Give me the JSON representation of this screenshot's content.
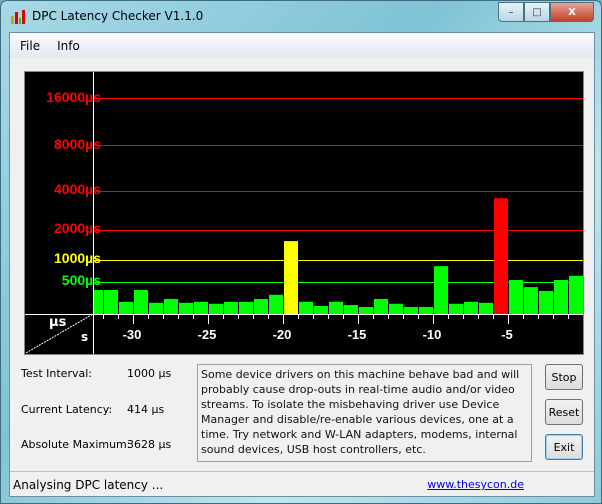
{
  "window": {
    "title": "DPC Latency Checker V1.1.0",
    "minimize": "–",
    "maximize": "□",
    "close": "X"
  },
  "menu": {
    "items": [
      "File",
      "Info"
    ]
  },
  "chart_data": {
    "type": "bar",
    "ylabels": [
      "16000µs",
      "8000µs",
      "4000µs",
      "2000µs",
      "1000µs",
      "500µs"
    ],
    "gridlines": [
      {
        "value": 16000,
        "color": "#ff0000"
      },
      {
        "value": 8000,
        "color": "#ff0000"
      },
      {
        "value": 4000,
        "color": "#ff0000"
      },
      {
        "value": 2000,
        "color": "#ff0000"
      },
      {
        "value": 1000,
        "color": "#ffff00"
      },
      {
        "value": 500,
        "color": "#00ff00"
      }
    ],
    "yunit": "µs",
    "xunit": "s",
    "xticks": [
      "-30",
      "-25",
      "-20",
      "-15",
      "-10",
      "-5"
    ],
    "xlim": [
      -33,
      0
    ],
    "colors": {
      "ok": "#00ff00",
      "warn": "#ffff00",
      "bad": "#ff0000"
    },
    "values": [
      375,
      375,
      190,
      375,
      175,
      235,
      175,
      190,
      160,
      190,
      190,
      235,
      300,
      1630,
      190,
      125,
      190,
      140,
      110,
      235,
      160,
      110,
      110,
      860,
      160,
      190,
      175,
      3628,
      545,
      420,
      360,
      545,
      640
    ]
  },
  "stats": {
    "test_interval_label": "Test Interval:",
    "test_interval": "1000 µs",
    "current_latency_label": "Current Latency:",
    "current_latency": "414 µs",
    "absolute_maximum_label": "Absolute Maximum:",
    "absolute_maximum": "3628 µs"
  },
  "message": "Some device drivers on this machine behave bad and will probably cause drop-outs in real-time audio and/or video streams. To isolate the misbehaving driver use Device Manager and disable/re-enable various devices, one at a time. Try network and W-LAN adapters, modems, internal sound devices, USB host controllers, etc.",
  "buttons": {
    "stop": "Stop",
    "reset": "Reset",
    "exit": "Exit"
  },
  "status": {
    "text": "Analysing DPC latency ...",
    "link": "www.thesycon.de"
  }
}
